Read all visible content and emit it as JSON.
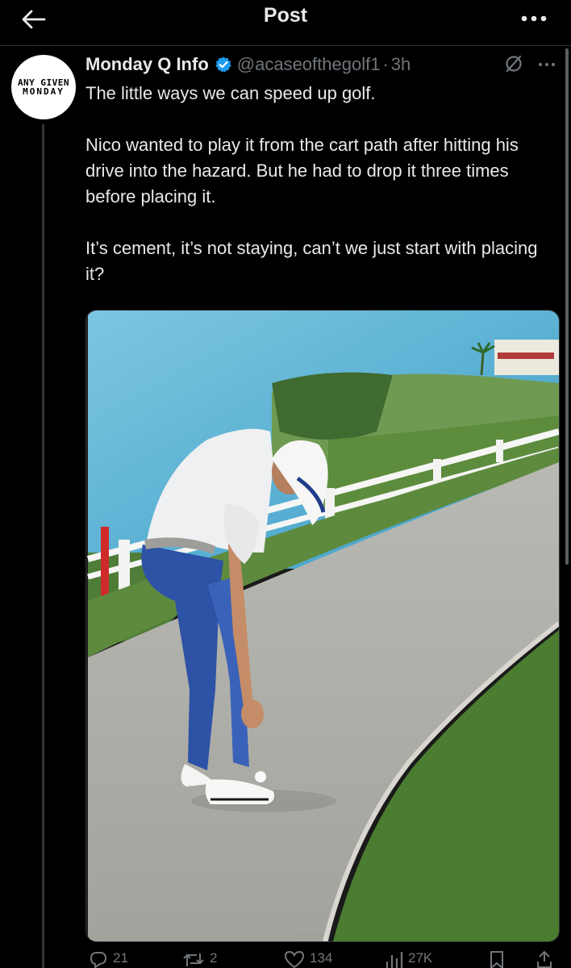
{
  "header": {
    "title": "Post",
    "back_icon": "arrow-left-icon",
    "more_icon": "more-horizontal-icon"
  },
  "author": {
    "avatar_text_line1": "ANY GIVEN",
    "avatar_text_line2": "MONDAY",
    "display_name": "Monday Q Info",
    "verified": true,
    "handle": "@acaseofthegolf1",
    "separator": "·",
    "time": "3h"
  },
  "tweet": {
    "paragraphs": [
      "The little ways we can speed up golf.",
      "Nico wanted to play it from the cart path after hitting his drive into the hazard.  But he had to drop it three times before placing it.",
      "It’s cement, it’s not staying, can’t we just start with placing it?"
    ],
    "media_watermark": "element"
  },
  "actions": {
    "replies": "21",
    "reposts": "2",
    "likes": "134",
    "views": "27K"
  },
  "colors": {
    "background": "#000000",
    "text": "#e7e9ea",
    "secondary": "#71767b",
    "verified_blue": "#1d9bf0",
    "divider": "#2f3336"
  }
}
